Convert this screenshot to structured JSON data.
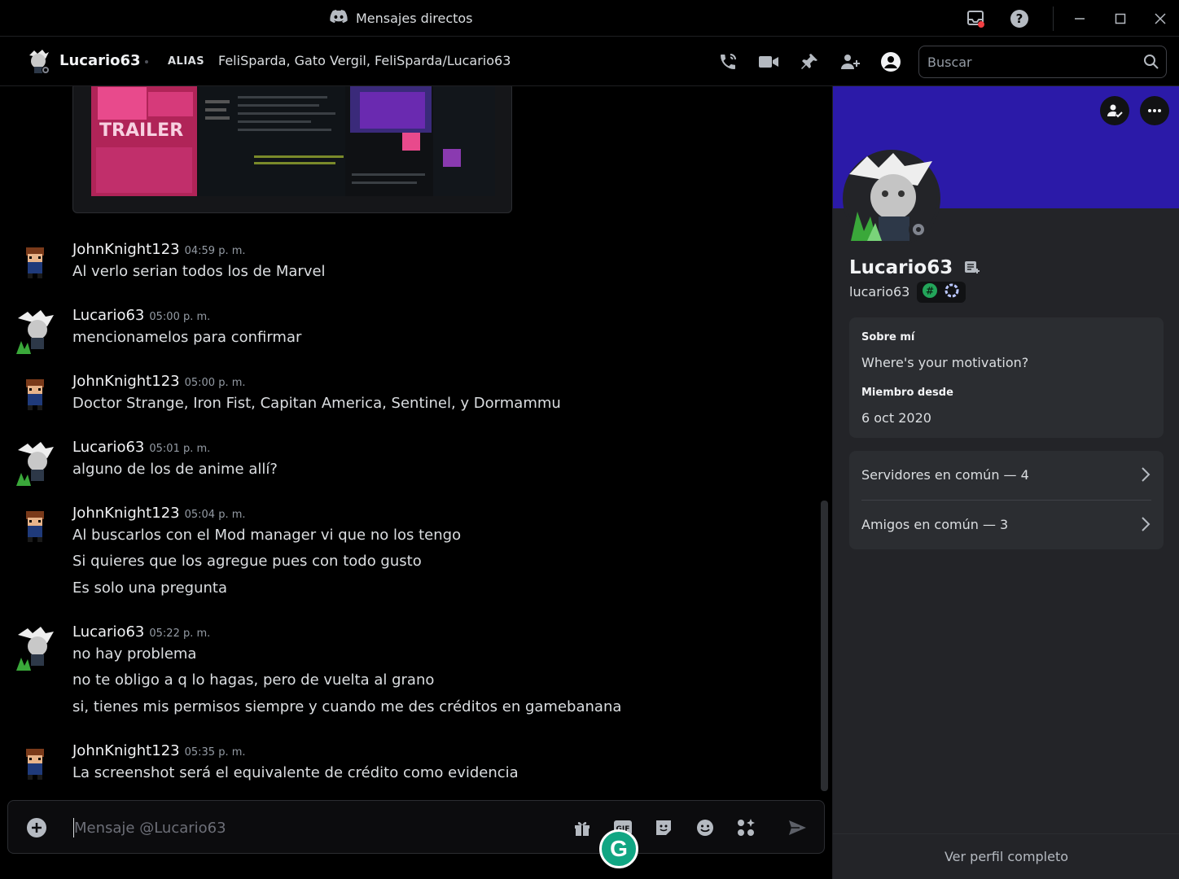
{
  "window": {
    "title": "Mensajes directos"
  },
  "header": {
    "name": "Lucario63",
    "alias_label": "ALIAS",
    "alias_value": "FeliSparda, Gato Vergil, FeliSparda/Lucario63",
    "search_placeholder": "Buscar",
    "icons": [
      "phone-call-icon",
      "video-call-icon",
      "pin-icon",
      "add-member-icon",
      "user-profile-icon",
      "search-icon"
    ]
  },
  "messages": [
    {
      "author": "JohnKnight123",
      "time": "04:59 p. m.",
      "lines": [
        "Al verlo serian todos los de Marvel"
      ]
    },
    {
      "author": "Lucario63",
      "time": "05:00 p. m.",
      "lines": [
        "mencionamelos para confirmar"
      ]
    },
    {
      "author": "JohnKnight123",
      "time": "05:00 p. m.",
      "lines": [
        "Doctor Strange, Iron Fist, Capitan America, Sentinel, y Dormammu"
      ]
    },
    {
      "author": "Lucario63",
      "time": "05:01 p. m.",
      "lines": [
        "alguno de los de anime allí?"
      ]
    },
    {
      "author": "JohnKnight123",
      "time": "05:04 p. m.",
      "lines": [
        "Al buscarlos con el Mod manager vi que no los tengo",
        "Si quieres que los agregue pues con todo gusto",
        "Es solo una pregunta"
      ]
    },
    {
      "author": "Lucario63",
      "time": "05:22 p. m.",
      "lines": [
        "no hay problema",
        "no te obligo a q lo hagas, pero de vuelta al grano",
        "si, tienes mis permisos siempre y cuando me des créditos en gamebanana"
      ]
    },
    {
      "author": "JohnKnight123",
      "time": "05:35 p. m.",
      "lines": [
        "La screenshot será el equivalente de crédito como evidencia"
      ]
    }
  ],
  "embed_text": {
    "trailer": "TRAILER"
  },
  "composer": {
    "placeholder": "Mensaje @Lucario63",
    "icons": [
      "add-attachment-icon",
      "gift-icon",
      "gif-icon",
      "sticker-icon",
      "emoji-icon",
      "apps-icon",
      "send-icon"
    ],
    "gif_label": "GIF",
    "grammarly_label": "G"
  },
  "profile": {
    "display_name": "Lucario63",
    "username": "lucario63",
    "about_label": "Sobre mí",
    "about_text": "Where's your motivation?",
    "member_since_label": "Miembro desde",
    "member_since_value": "6 oct 2020",
    "mutual_servers": "Servidores en común — 4",
    "mutual_friends": "Amigos en común — 3",
    "view_full": "Ver perfil completo"
  },
  "colors": {
    "banner": "#2b1aa8",
    "background": "#000000",
    "panel": "#232428",
    "card": "#2b2d31",
    "accent_green": "#11a683",
    "status_offline": "#80848e"
  }
}
